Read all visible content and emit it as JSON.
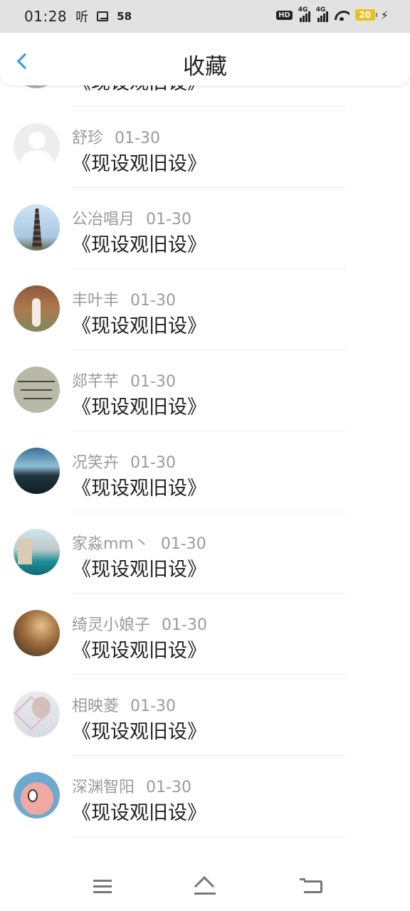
{
  "status_bar": {
    "time": "01:28",
    "ting": "听",
    "notification_count": "58",
    "hd_label": "HD",
    "net1": "4G",
    "net2": "4G",
    "battery": "20"
  },
  "header": {
    "title": "收藏"
  },
  "items": [
    {
      "name": "",
      "date": "",
      "title": "《现设观旧设》"
    },
    {
      "name": "舒珍",
      "date": "01-30",
      "title": "《现设观旧设》"
    },
    {
      "name": "公冶唱月",
      "date": "01-30",
      "title": "《现设观旧设》"
    },
    {
      "name": "丰叶丰",
      "date": "01-30",
      "title": "《现设观旧设》"
    },
    {
      "name": "郯芊芊",
      "date": "01-30",
      "title": "《现设观旧设》"
    },
    {
      "name": "况笑卉",
      "date": "01-30",
      "title": "《现设观旧设》"
    },
    {
      "name": "家淼mm丶",
      "date": "01-30",
      "title": "《现设观旧设》"
    },
    {
      "name": "绮灵小娘子",
      "date": "01-30",
      "title": "《现设观旧设》"
    },
    {
      "name": "相映菱",
      "date": "01-30",
      "title": "《现设观旧设》"
    },
    {
      "name": "深渊智阳",
      "date": "01-30",
      "title": "《现设观旧设》"
    }
  ],
  "icons": {
    "back": "back-arrow-icon",
    "nav_menu": "menu-icon",
    "nav_home": "home-icon",
    "nav_back": "back-nav-icon"
  },
  "colors": {
    "accent": "#2c9be8",
    "meta_text": "#9a9a9a",
    "title_text": "#222222"
  }
}
